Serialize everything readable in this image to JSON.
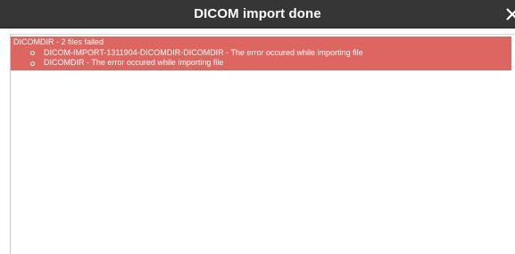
{
  "dialog": {
    "title": "DICOM import done",
    "close_icon": "close-icon"
  },
  "error": {
    "summary": "DICOMDIR - 2 files failed",
    "background_color": "#de6661",
    "items": [
      {
        "text": "DICOM-IMPORT-1311904-DICOMDIR-DICOMDIR - The error occured while importing file"
      },
      {
        "text": "DICOMDIR - The error occured while importing file"
      }
    ]
  }
}
